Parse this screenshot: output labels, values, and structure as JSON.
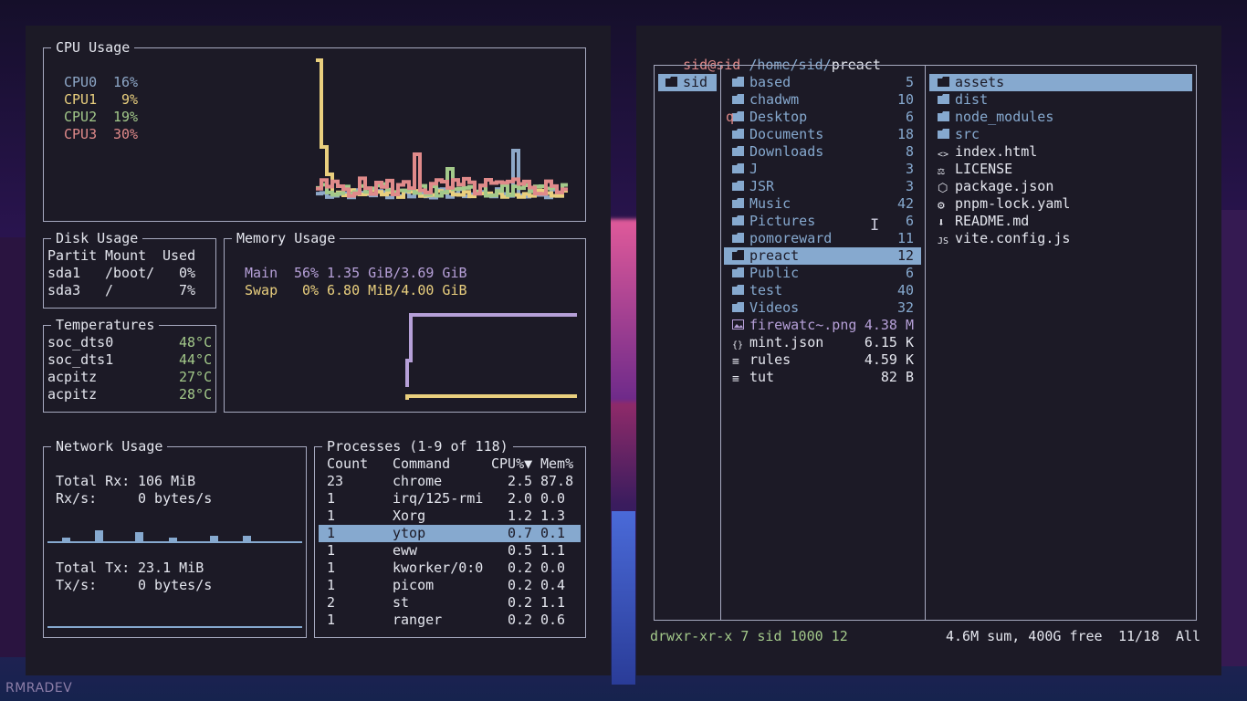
{
  "watermark": "RMRADEV",
  "ytop": {
    "cpu": {
      "title": "CPU Usage",
      "cores": [
        {
          "name": "CPU0",
          "value": "16%",
          "color": "#8ea8c8"
        },
        {
          "name": "CPU1",
          "value": "9%",
          "color": "#e9cf7e"
        },
        {
          "name": "CPU2",
          "value": "19%",
          "color": "#a3c98a"
        },
        {
          "name": "CPU3",
          "value": "30%",
          "color": "#e08a8a"
        }
      ]
    },
    "disk": {
      "title": "Disk Usage",
      "headers": [
        "Partit",
        "Mount",
        "Used"
      ],
      "rows": [
        [
          "sda1",
          "/boot/",
          "0%"
        ],
        [
          "sda3",
          "/",
          "7%"
        ]
      ]
    },
    "memory": {
      "title": "Memory Usage",
      "rows": [
        {
          "name": "Main",
          "pct": "56%",
          "detail": "1.35 GiB/3.69 GiB",
          "color": "#b6a0d8"
        },
        {
          "name": "Swap",
          "pct": "0%",
          "detail": "6.80 MiB/4.00 GiB",
          "color": "#e9cf7e"
        }
      ]
    },
    "temps": {
      "title": "Temperatures",
      "rows": [
        {
          "name": "soc_dts0",
          "value": "48°C"
        },
        {
          "name": "soc_dts1",
          "value": "44°C"
        },
        {
          "name": "acpitz",
          "value": "27°C"
        },
        {
          "name": "acpitz",
          "value": "28°C"
        }
      ]
    },
    "network": {
      "title": "Network Usage",
      "rx_total_label": "Total Rx:",
      "rx_total": "106 MiB",
      "rx_rate_label": "Rx/s:",
      "rx_rate": "0 bytes/s",
      "tx_total_label": "Total Tx:",
      "tx_total": "23.1 MiB",
      "tx_rate_label": "Tx/s:",
      "tx_rate": "0 bytes/s"
    },
    "processes": {
      "title": "Processes (1-9 of 118)",
      "headers": [
        "Count",
        "Command",
        "CPU%▼",
        "Mem%"
      ],
      "rows": [
        [
          "23",
          "chrome",
          "2.5",
          "87.8"
        ],
        [
          "1",
          "irq/125-rmi",
          "2.0",
          "0.0"
        ],
        [
          "1",
          "Xorg",
          "1.2",
          "1.3"
        ],
        [
          "1",
          "ytop",
          "0.7",
          "0.1"
        ],
        [
          "1",
          "eww",
          "0.5",
          "1.1"
        ],
        [
          "1",
          "kworker/0:0",
          "0.2",
          "0.0"
        ],
        [
          "1",
          "picom",
          "0.2",
          "0.4"
        ],
        [
          "2",
          "st",
          "0.2",
          "1.1"
        ],
        [
          "1",
          "ranger",
          "0.2",
          "0.6"
        ]
      ],
      "selected_index": 3
    }
  },
  "ranger": {
    "prompt_user": "sid@sid",
    "prompt_path": "/home/sid/",
    "prompt_dir": "preact",
    "parent": [
      {
        "icon": "folder-icon",
        "name": "sid"
      }
    ],
    "current": [
      {
        "icon": "folder-icon",
        "name": "based",
        "size": "5"
      },
      {
        "icon": "folder-icon",
        "name": "chadwm",
        "size": "10"
      },
      {
        "icon": "folder-icon",
        "name": "Desktop",
        "size": "6"
      },
      {
        "icon": "folder-icon",
        "name": "Documents",
        "size": "18"
      },
      {
        "icon": "folder-icon",
        "name": "Downloads",
        "size": "8"
      },
      {
        "icon": "folder-icon",
        "name": "J",
        "size": "3"
      },
      {
        "icon": "folder-icon",
        "name": "JSR",
        "size": "3"
      },
      {
        "icon": "folder-icon",
        "name": "Music",
        "size": "42"
      },
      {
        "icon": "folder-icon",
        "name": "Pictures",
        "size": "6"
      },
      {
        "icon": "folder-icon",
        "name": "pomoreward",
        "size": "11"
      },
      {
        "icon": "folder-icon",
        "name": "preact",
        "size": "12"
      },
      {
        "icon": "folder-icon",
        "name": "Public",
        "size": "6"
      },
      {
        "icon": "folder-icon",
        "name": "test",
        "size": "40"
      },
      {
        "icon": "folder-icon",
        "name": "Videos",
        "size": "32"
      },
      {
        "icon": "image-icon",
        "name": "firewatc~.png",
        "size": "4.38 M"
      },
      {
        "icon": "json-icon",
        "name": "mint.json",
        "size": "6.15 K"
      },
      {
        "icon": "text-icon",
        "name": "rules",
        "size": "4.59 K"
      },
      {
        "icon": "text-icon",
        "name": "tut",
        "size": "82 B"
      }
    ],
    "selected_index": 10,
    "preview": [
      {
        "icon": "folder-icon",
        "name": "assets"
      },
      {
        "icon": "folder-icon",
        "name": "dist"
      },
      {
        "icon": "folder-icon",
        "name": "node_modules"
      },
      {
        "icon": "folder-icon",
        "name": "src"
      },
      {
        "icon": "code-icon",
        "name": "index.html"
      },
      {
        "icon": "license-icon",
        "name": "LICENSE"
      },
      {
        "icon": "package-icon",
        "name": "package.json"
      },
      {
        "icon": "gear-icon",
        "name": "pnpm-lock.yaml"
      },
      {
        "icon": "download-icon",
        "name": "README.md"
      },
      {
        "icon": "js-icon",
        "name": "vite.config.js"
      }
    ],
    "status_perms": "drwxr-xr-x 7 sid 1000 12",
    "status_disk": "4.6M sum, 400G free",
    "status_pos": "11/18",
    "status_all": "All",
    "stray_char": "q"
  }
}
